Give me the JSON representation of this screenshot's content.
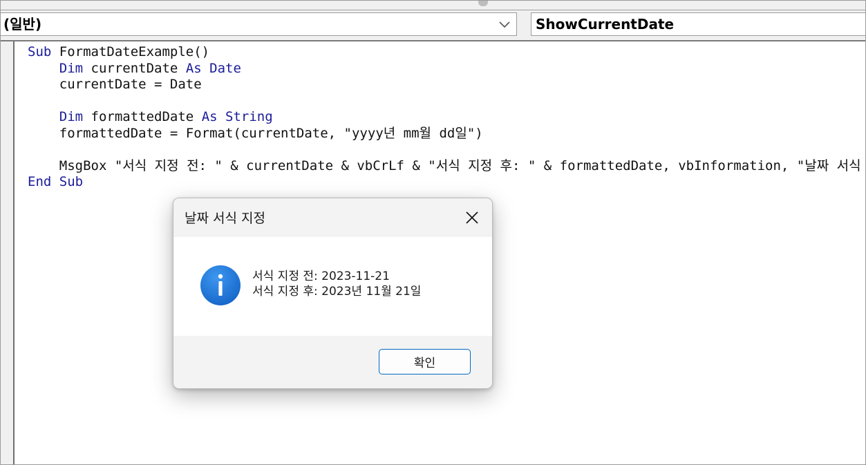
{
  "toolbar": {
    "object_combo": "(일반)",
    "procedure_combo": "ShowCurrentDate"
  },
  "code": {
    "lines": [
      [
        {
          "t": "Sub",
          "k": true
        },
        {
          "t": " FormatDateExample()"
        }
      ],
      [
        {
          "t": "    "
        },
        {
          "t": "Dim",
          "k": true
        },
        {
          "t": " currentDate "
        },
        {
          "t": "As",
          "k": true
        },
        {
          "t": " "
        },
        {
          "t": "Date",
          "k": true
        }
      ],
      [
        {
          "t": "    currentDate = Date"
        }
      ],
      [
        {
          "t": ""
        }
      ],
      [
        {
          "t": "    "
        },
        {
          "t": "Dim",
          "k": true
        },
        {
          "t": " formattedDate "
        },
        {
          "t": "As",
          "k": true
        },
        {
          "t": " "
        },
        {
          "t": "String",
          "k": true
        }
      ],
      [
        {
          "t": "    formattedDate = Format(currentDate, \"yyyy년 mm월 dd일\")"
        }
      ],
      [
        {
          "t": ""
        }
      ],
      [
        {
          "t": "    MsgBox \"서식 지정 전: \" & currentDate & vbCrLf & \"서식 지정 후: \" & formattedDate, vbInformation, \"날짜 서식 지정\""
        }
      ],
      [
        {
          "t": "End Sub",
          "k": true
        }
      ]
    ]
  },
  "dialog": {
    "title": "날짜 서식 지정",
    "line1": "서식 지정 전: 2023-11-21",
    "line2": "서식 지정 후: 2023년 11월 21일",
    "ok_label": "확인",
    "icon": "info-icon"
  },
  "colors": {
    "keyword": "#1b1b9a",
    "info_icon": "#1a73d6",
    "button_border": "#0067c0"
  }
}
